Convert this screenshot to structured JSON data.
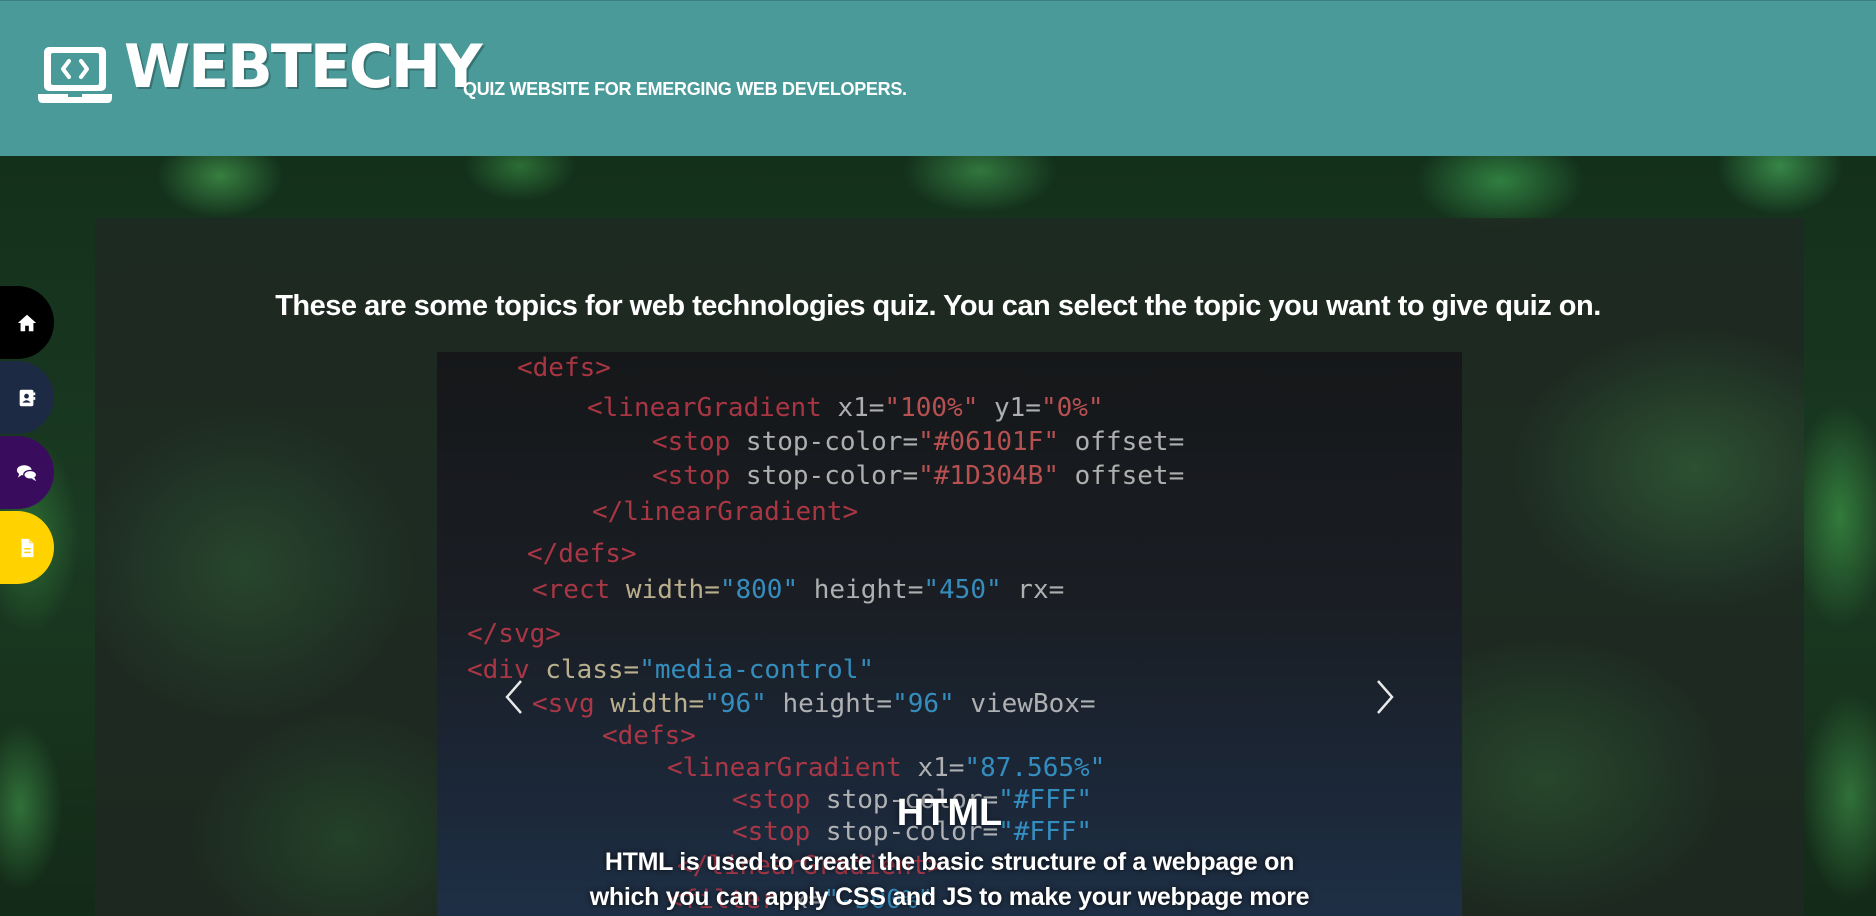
{
  "header": {
    "brand": "WEBTECHY",
    "tagline": "QUIZ WEBSITE FOR EMERGING WEB DEVELOPERS.",
    "logo_icon": "laptop-code-icon",
    "background_color": "#4a9a99"
  },
  "side_nav": {
    "items": [
      {
        "icon": "home-icon",
        "color": "#000000"
      },
      {
        "icon": "address-book-icon",
        "color": "#1c2a44"
      },
      {
        "icon": "comments-icon",
        "color": "#3a0c5e"
      },
      {
        "icon": "file-icon",
        "color": "#ffd200"
      }
    ]
  },
  "main": {
    "intro": "These are some topics for web technologies quiz. You can select the topic you want to give quiz on."
  },
  "carousel": {
    "prev_icon": "chevron-left-icon",
    "next_icon": "chevron-right-icon",
    "slide": {
      "title": "HTML",
      "text": "HTML is used to create the basic structure of a webpage on which you can apply CSS and JS to make your webpage more"
    }
  }
}
